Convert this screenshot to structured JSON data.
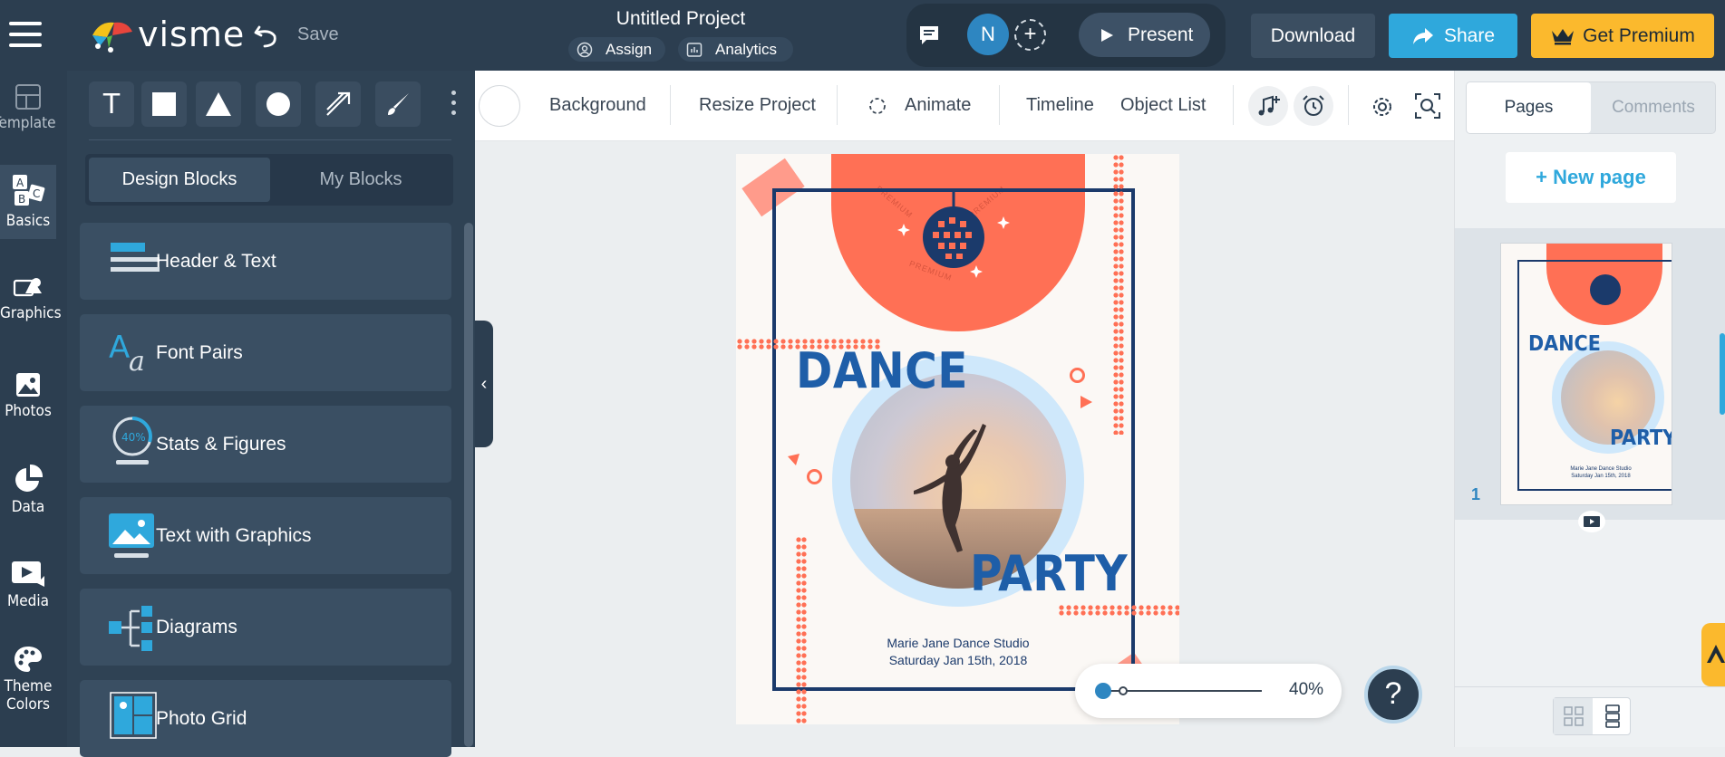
{
  "header": {
    "logo_text": "visme",
    "save_label": "Save",
    "project_title": "Untitled Project",
    "assign_label": "Assign",
    "analytics_label": "Analytics",
    "avatar_initial": "N",
    "present_label": "Present",
    "download_label": "Download",
    "share_label": "Share",
    "premium_label": "Get Premium"
  },
  "rail": {
    "items": [
      {
        "label": "Templates"
      },
      {
        "label": "Basics"
      },
      {
        "label": "Graphics"
      },
      {
        "label": "Photos"
      },
      {
        "label": "Data"
      },
      {
        "label": "Media"
      },
      {
        "label": "Theme"
      },
      {
        "label": "Colors"
      }
    ]
  },
  "panel": {
    "tabs": [
      {
        "label": "Design Blocks"
      },
      {
        "label": "My Blocks"
      }
    ],
    "blocks": [
      {
        "label": "Header & Text"
      },
      {
        "label": "Font Pairs"
      },
      {
        "label": "Stats & Figures",
        "icon_text": "40%"
      },
      {
        "label": "Text with Graphics"
      },
      {
        "label": "Diagrams"
      },
      {
        "label": "Photo Grid"
      }
    ],
    "tool_t": "T"
  },
  "toolbar": {
    "background": "Background",
    "resize": "Resize Project",
    "animate": "Animate",
    "timeline": "Timeline",
    "object_list": "Object List"
  },
  "right": {
    "tab_pages": "Pages",
    "tab_comments": "Comments",
    "new_page": "+ New page",
    "page_number": "1"
  },
  "poster": {
    "title_top": "DANCE",
    "title_bottom": "PARTY",
    "studio": "Marie Jane Dance Studio",
    "date": "Saturday Jan 15th, 2018",
    "arc_text": "PREMIUM",
    "thumb_studio": "Marie Jane Dance Studio",
    "thumb_date": "Saturday Jan 15th, 2018"
  },
  "zoom": {
    "label": "40%",
    "value": 0.4
  },
  "help": {
    "label": "?"
  },
  "colors": {
    "topbar": "#2c3e50",
    "share": "#2fa8dc",
    "premium": "#fbb92d",
    "coral": "#ff7055",
    "navy": "#1b3a6b",
    "blue": "#1e5ea8"
  }
}
